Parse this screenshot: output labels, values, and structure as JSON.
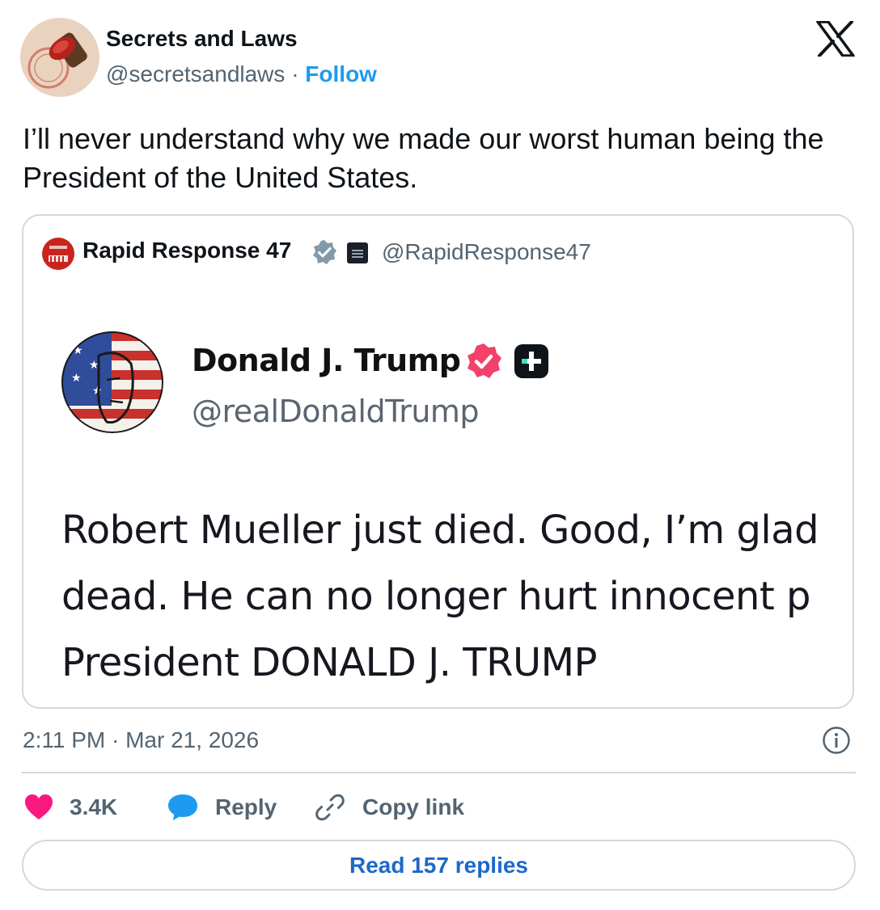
{
  "author": {
    "name": "Secrets and Laws",
    "handle": "@secretsandlaws",
    "separator": "·",
    "follow_label": "Follow"
  },
  "tweet_text": "I’ll never understand why we made our worst human being the President of the United States.",
  "quoted": {
    "name": "Rapid Response 47",
    "handle": "@RapidResponse47",
    "embedded_post": {
      "name": "Donald J. Trump",
      "handle": "@realDonaldTrump",
      "lines": [
        "Robert Mueller just died. Good, I’m glad",
        "dead. He can no longer hurt innocent p",
        "President DONALD J. TRUMP"
      ]
    }
  },
  "timestamp": "2:11 PM · Mar 21, 2026",
  "actions": {
    "likes": "3.4K",
    "reply_label": "Reply",
    "copy_link_label": "Copy link"
  },
  "read_replies_label": "Read 157 replies",
  "colors": {
    "accent": "#1d9bf0",
    "like": "#f91880",
    "muted": "#536471",
    "border": "#cfd9de"
  },
  "icons": [
    "x-logo-icon",
    "verified-badge-icon",
    "like-heart-icon",
    "reply-bubble-icon",
    "link-icon",
    "info-icon"
  ]
}
